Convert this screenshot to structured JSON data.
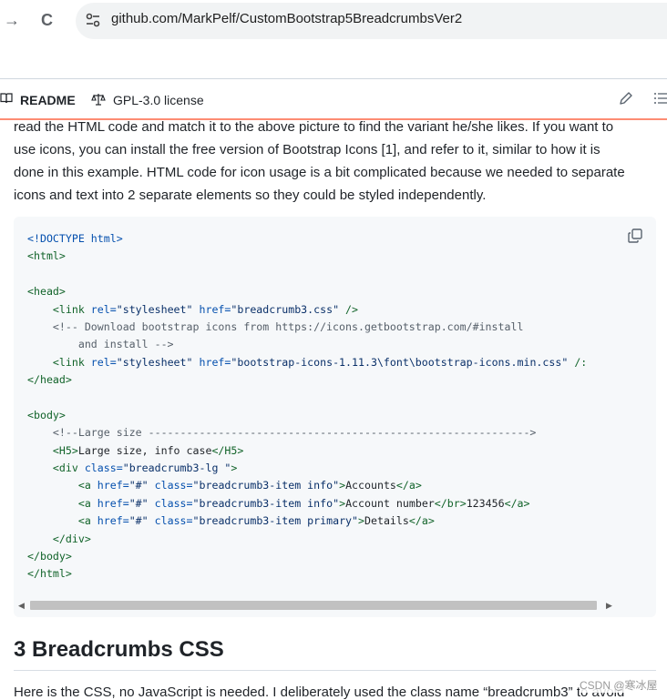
{
  "browser": {
    "url": "github.com/MarkPelf/CustomBootstrap5BreadcrumbsVer2"
  },
  "readme_header": {
    "readme_tab": "README",
    "license_tab": "GPL-3.0 license"
  },
  "paragraph": {
    "lines": [
      "read the HTML code and match it to the above picture to find the variant he/she likes. If you want to",
      "use icons, you can install the free version of Bootstrap Icons [1], and refer to it, similar to how it is",
      "done in this example. HTML code for icon usage is a bit complicated because we needed to separate",
      "icons and text into 2 separate elements so they could be styled independently."
    ]
  },
  "code": {
    "l01": "<!DOCTYPE html>",
    "l02": "<html>",
    "l04": "<head>",
    "l05_indent": "    ",
    "l05_tag_open": "<link",
    "l05_attr1": " rel=",
    "l05_val1": "\"stylesheet\"",
    "l05_attr2": " href=",
    "l05_val2": "\"breadcrumb3.css\"",
    "l05_close": " />",
    "l06": "    <!-- Download bootstrap icons from https://icons.getbootstrap.com/#install",
    "l07": "        and install -->",
    "l08_indent": "    ",
    "l08_tag_open": "<link",
    "l08_attr1": " rel=",
    "l08_val1": "\"stylesheet\"",
    "l08_attr2": " href=",
    "l08_val2": "\"bootstrap-icons-1.11.3\\font\\bootstrap-icons.min.css\"",
    "l08_close": " /:",
    "l09": "</head>",
    "l11": "<body>",
    "l12": "    <!--Large size ------------------------------------------------------------>",
    "l13_indent": "    ",
    "l13_open": "<H5>",
    "l13_text": "Large size, info case",
    "l13_close": "</H5>",
    "l14_indent": "    ",
    "l14_tag": "<div",
    "l14_attr": " class=",
    "l14_val": "\"breadcrumb3-lg \"",
    "l14_end": ">",
    "l15_indent": "        ",
    "l15_tag": "<a",
    "l15_attr1": " href=",
    "l15_val1": "\"#\"",
    "l15_attr2": " class=",
    "l15_val2": "\"breadcrumb3-item info\"",
    "l15_gt": ">",
    "l15_text": "Accounts",
    "l15_close": "</a>",
    "l16_indent": "        ",
    "l16_tag": "<a",
    "l16_attr1": " href=",
    "l16_val1": "\"#\"",
    "l16_attr2": " class=",
    "l16_val2": "\"breadcrumb3-item info\"",
    "l16_gt": ">",
    "l16_text1": "Account number",
    "l16_br": "</br>",
    "l16_text2": "123456",
    "l16_close": "</a>",
    "l17_indent": "        ",
    "l17_tag": "<a",
    "l17_attr1": " href=",
    "l17_val1": "\"#\"",
    "l17_attr2": " class=",
    "l17_val2": "\"breadcrumb3-item primary\"",
    "l17_gt": ">",
    "l17_text": "Details",
    "l17_close": "</a>",
    "l18": "    </div>",
    "l19": "</body>",
    "l20": "</html>"
  },
  "section": {
    "heading": "3 Breadcrumbs CSS",
    "cutoff_text": "Here is the CSS, no JavaScript is needed. I deliberately used the class name “breadcrumb3” to avoid"
  },
  "watermark": "CSDN @寒冰屋",
  "icons": {
    "back": "arrow-back-icon",
    "reload": "reload-icon",
    "site_info": "tune-icon",
    "readme": "book-icon",
    "license": "scale-icon",
    "edit": "pencil-icon",
    "outline": "list-icon",
    "copy": "copy-icon"
  }
}
